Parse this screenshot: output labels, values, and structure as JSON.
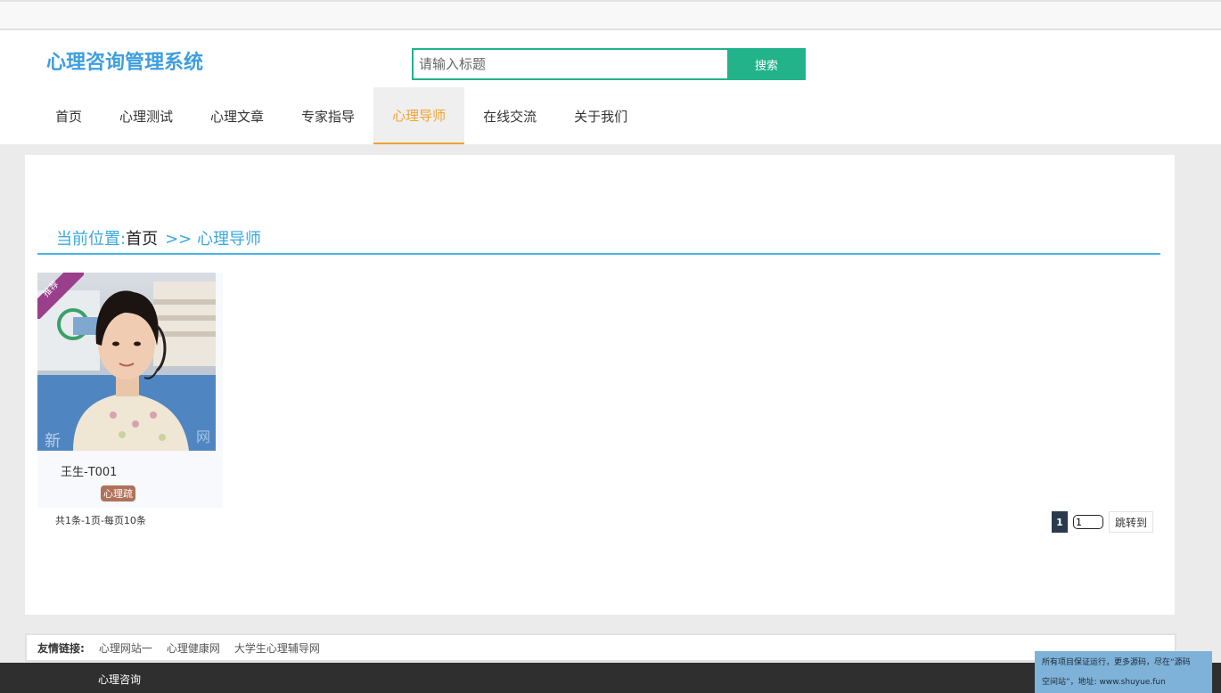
{
  "header": {
    "logo": "心理咨询管理系统",
    "search_placeholder": "请输入标题",
    "search_button": "搜索"
  },
  "nav": {
    "items": [
      {
        "label": "首页"
      },
      {
        "label": "心理测试"
      },
      {
        "label": "心理文章"
      },
      {
        "label": "专家指导"
      },
      {
        "label": "心理导师",
        "active": true
      },
      {
        "label": "在线交流"
      },
      {
        "label": "关于我们"
      }
    ]
  },
  "breadcrumb": {
    "prefix": "当前位置:",
    "home": "首页",
    "current": ">> 心理导师"
  },
  "card": {
    "ribbon": "推荐",
    "name": "王生-T001",
    "tag": "心理疏"
  },
  "pagination": {
    "info": "共1条-1页-每页10条",
    "current_page": "1",
    "jump_value": "1",
    "jump_button": "跳转到"
  },
  "links": {
    "label": "友情链接:",
    "items": [
      "心理网站一",
      "心理健康网",
      "大学生心理辅导网"
    ]
  },
  "footer": {
    "text": "心理咨询"
  },
  "notice": {
    "line1": "所有项目保证运行，更多源码，尽在“源码",
    "line2": "空间站”，地址: www.shuyue.fun"
  },
  "colors": {
    "brand_blue": "#3d9ee0",
    "search_green": "#22b38a",
    "nav_active": "#f0a331",
    "breadcrumb_blue": "#3aa8e0",
    "ribbon_purple": "#9a3f8c",
    "tag_brown": "#b0715a",
    "footer_dark": "#2f2f2f"
  }
}
